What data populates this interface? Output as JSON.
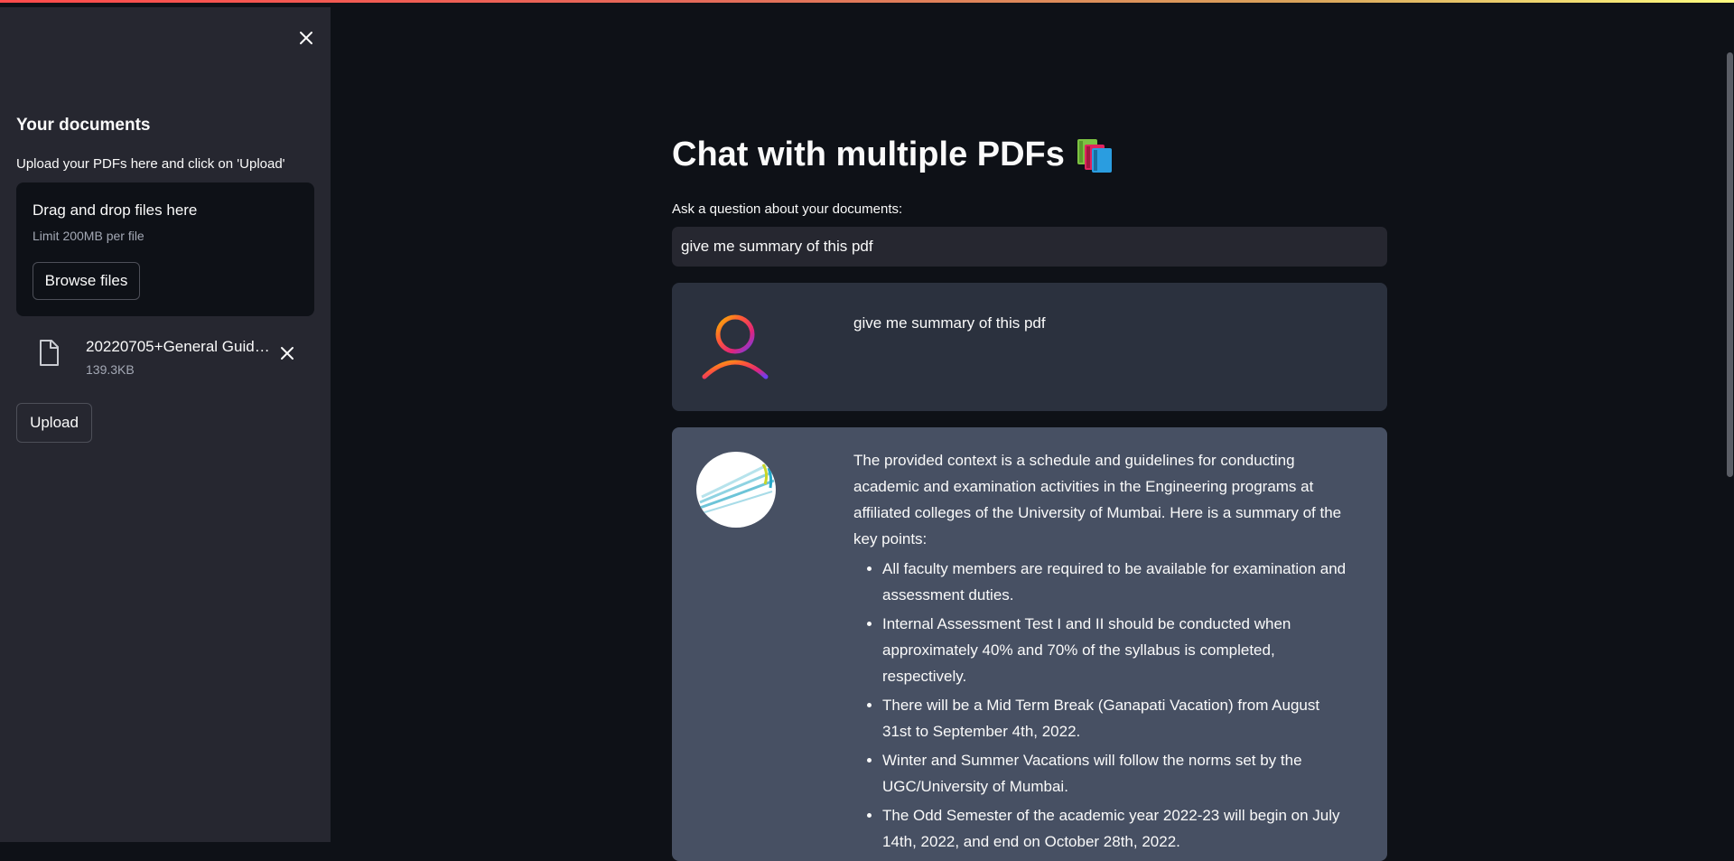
{
  "sidebar": {
    "title": "Your documents",
    "upload_label": "Upload your PDFs here and click on 'Upload'",
    "dropzone": {
      "title": "Drag and drop files here",
      "limit": "Limit 200MB per file",
      "browse_label": "Browse files"
    },
    "file": {
      "name": "20220705+General Guidel...",
      "size": "139.3KB"
    },
    "upload_button": "Upload"
  },
  "main": {
    "title": "Chat with multiple PDFs",
    "question_label": "Ask a question about your documents:",
    "question_value": "give me summary of this pdf",
    "messages": {
      "user": "give me summary of this pdf",
      "bot": {
        "intro": "The provided context is a schedule and guidelines for conducting academic and examination activities in the Engineering programs at affiliated colleges of the University of Mumbai. Here is a summary of the key points:",
        "bullets": [
          "All faculty members are required to be available for examination and assessment duties.",
          "Internal Assessment Test I and II should be conducted when approximately 40% and 70% of the syllabus is completed, respectively.",
          "There will be a Mid Term Break (Ganapati Vacation) from August 31st to September 4th, 2022.",
          "Winter and Summer Vacations will follow the norms set by the UGC/University of Mumbai.",
          "The Odd Semester of the academic year 2022-23 will begin on July 14th, 2022, and end on October 28th, 2022."
        ]
      }
    }
  },
  "icons": {
    "sidebar_close": "close-icon",
    "file": "file-icon",
    "file_remove": "close-icon",
    "title_emoji": "books-icon",
    "user_avatar": "user-avatar-icon",
    "bot_avatar": "bot-avatar-icon"
  },
  "colors": {
    "background": "#0e1117",
    "sidebar": "#262730",
    "user_message": "#2b313e",
    "bot_message": "#475063",
    "accent": "#ff4b4b"
  }
}
